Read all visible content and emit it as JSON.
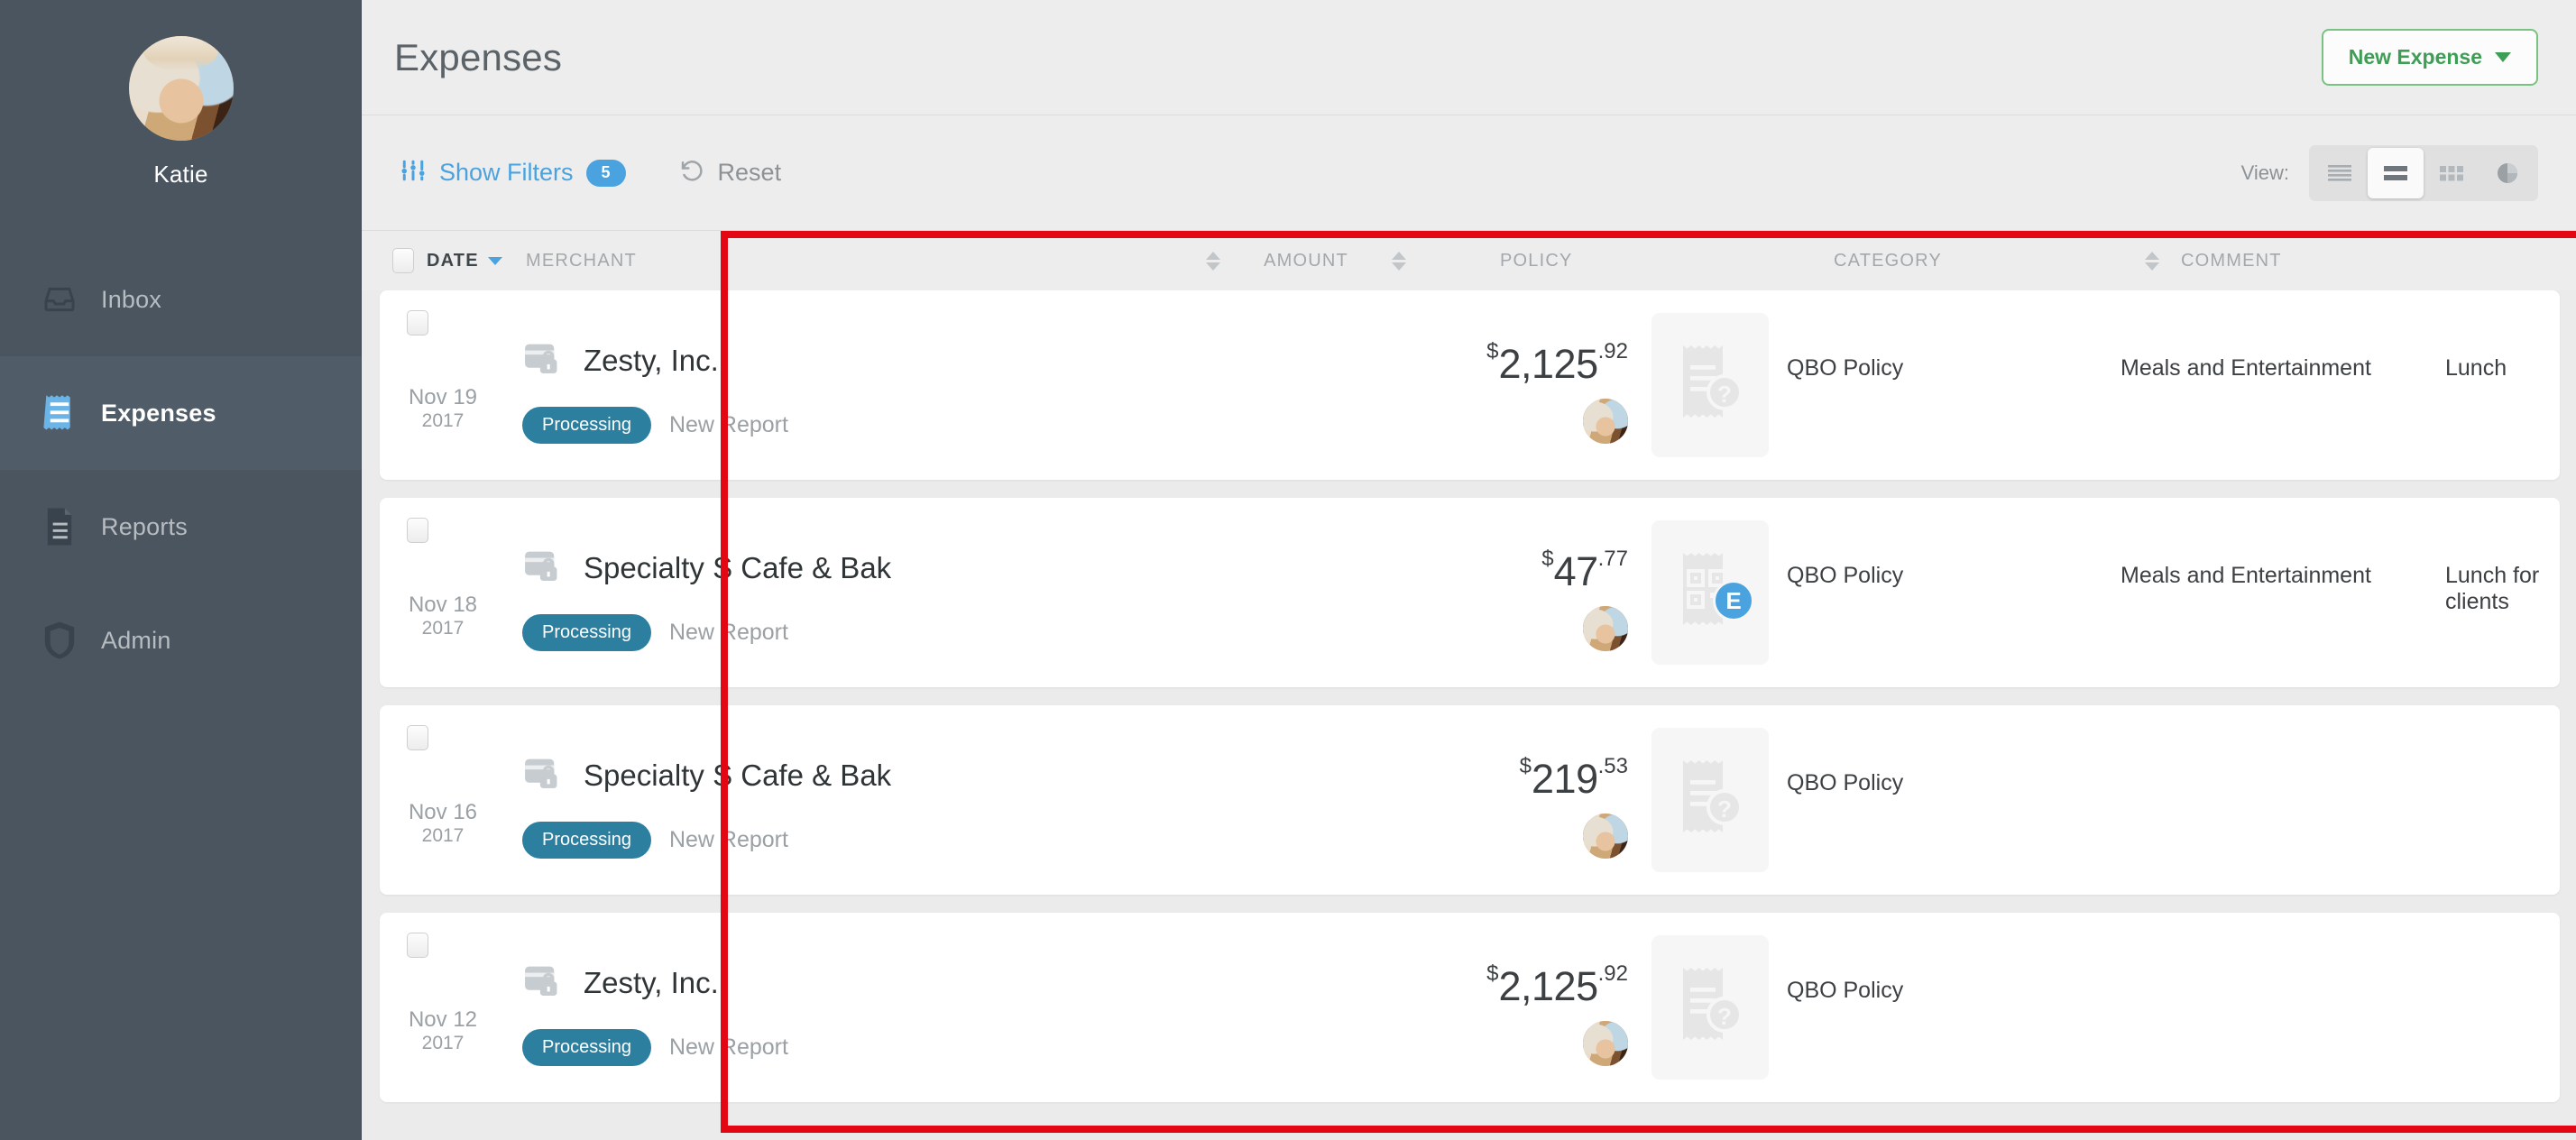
{
  "sidebar": {
    "user_name": "Katie",
    "avatar_name": "katie-avatar",
    "items": [
      {
        "label": "Inbox",
        "icon": "inbox-icon",
        "active": false
      },
      {
        "label": "Expenses",
        "icon": "receipt-icon",
        "active": true
      },
      {
        "label": "Reports",
        "icon": "document-icon",
        "active": false
      },
      {
        "label": "Admin",
        "icon": "shield-icon",
        "active": false
      }
    ]
  },
  "header": {
    "title": "Expenses",
    "new_expense_label": "New Expense"
  },
  "toolbar": {
    "show_filters_label": "Show Filters",
    "filter_count": "5",
    "reset_label": "Reset",
    "view_label": "View:",
    "views": [
      {
        "name": "list-view",
        "active": false
      },
      {
        "name": "compact-list-view",
        "active": true
      },
      {
        "name": "grid-view",
        "active": false
      },
      {
        "name": "chart-view",
        "active": false
      }
    ]
  },
  "table": {
    "columns": [
      {
        "key": "date",
        "label": "DATE",
        "sort": "desc",
        "active": true
      },
      {
        "key": "merchant",
        "label": "MERCHANT",
        "sort": "none",
        "active": false
      },
      {
        "key": "amount",
        "label": "AMOUNT",
        "sort": "none",
        "active": false
      },
      {
        "key": "policy",
        "label": "POLICY",
        "sort": "none",
        "active": false
      },
      {
        "key": "category",
        "label": "CATEGORY",
        "sort": "none",
        "active": false
      },
      {
        "key": "comment",
        "label": "COMMENT",
        "sort": "none",
        "active": false
      }
    ],
    "rows": [
      {
        "date_md": "Nov 19",
        "date_yr": "2017",
        "merchant": "Zesty, Inc.",
        "status": "Processing",
        "report": "New Report",
        "currency": "$",
        "amount_int": "2,125",
        "amount_cents": ".92",
        "receipt": "receipt-missing",
        "ereceipt_badge": "",
        "policy": "QBO Policy",
        "category": "Meals and Entertainment",
        "comment": "Lunch"
      },
      {
        "date_md": "Nov 18",
        "date_yr": "2017",
        "merchant": "Specialty S Cafe & Bak",
        "status": "Processing",
        "report": "New Report",
        "currency": "$",
        "amount_int": "47",
        "amount_cents": ".77",
        "receipt": "receipt-ereceipt",
        "ereceipt_badge": "E",
        "policy": "QBO Policy",
        "category": "Meals and Entertainment",
        "comment": "Lunch for clients"
      },
      {
        "date_md": "Nov 16",
        "date_yr": "2017",
        "merchant": "Specialty S Cafe & Bak",
        "status": "Processing",
        "report": "New Report",
        "currency": "$",
        "amount_int": "219",
        "amount_cents": ".53",
        "receipt": "receipt-missing",
        "ereceipt_badge": "",
        "policy": "QBO Policy",
        "category": "",
        "comment": ""
      },
      {
        "date_md": "Nov 12",
        "date_yr": "2017",
        "merchant": "Zesty, Inc.",
        "status": "Processing",
        "report": "New Report",
        "currency": "$",
        "amount_int": "2,125",
        "amount_cents": ".92",
        "receipt": "receipt-missing",
        "ereceipt_badge": "",
        "policy": "QBO Policy",
        "category": "",
        "comment": ""
      }
    ]
  },
  "colors": {
    "sidebar_bg": "#4a5560",
    "accent_blue": "#4aa3df",
    "accent_green": "#3e9e55",
    "status_pill": "#2d7fa0",
    "annotation_red": "#e30613"
  }
}
